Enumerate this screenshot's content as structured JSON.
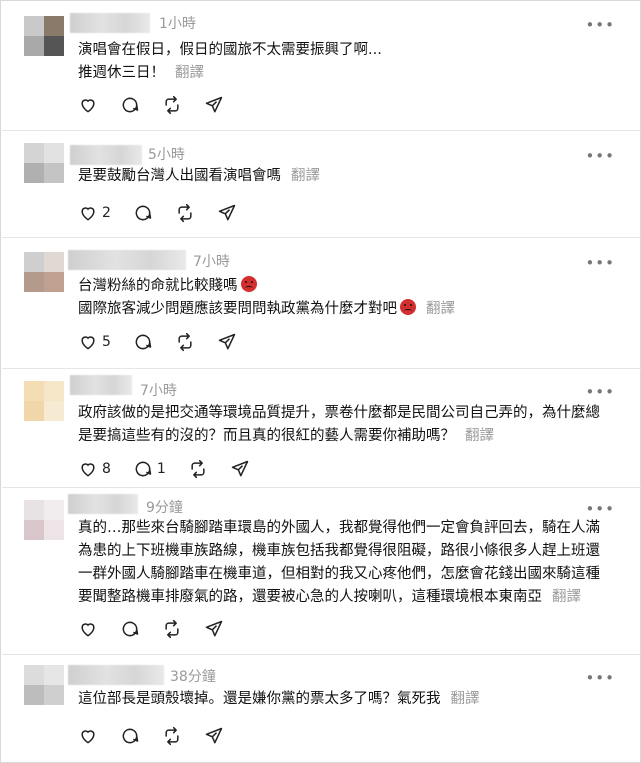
{
  "posts": [
    {
      "time": "1小時",
      "lines": [
        "演唱會在假日，假日的國旅不太需要振興了啊...",
        "推週休三日！"
      ],
      "translate": "翻譯",
      "likes": "",
      "replies": ""
    },
    {
      "time": "5小時",
      "lines": [
        "是要鼓勵台灣人出國看演唱會嗎"
      ],
      "translate": "翻譯",
      "likes": "2",
      "replies": ""
    },
    {
      "time": "7小時",
      "lines": [
        "台灣粉絲的命就比較賤嗎",
        "國際旅客減少問題應該要問問執政黨為什麼才對吧"
      ],
      "translate": "翻譯",
      "likes": "5",
      "replies": ""
    },
    {
      "time": "7小時",
      "lines": [
        "政府該做的是把交通等環境品質提升，票卷什麼都是民間公司自己弄的，為什麼總",
        "是要搞這些有的沒的？而且真的很紅的藝人需要你補助嗎？"
      ],
      "translate": "翻譯",
      "likes": "8",
      "replies": "1"
    },
    {
      "time": "9分鐘",
      "lines": [
        "真的…那些來台騎腳踏車環島的外國人，我都覺得他們一定會負評回去，騎在人滿",
        "為患的上下班機車族路線，機車族包括我都覺得很阻礙，路很小條很多人趕上班還",
        "一群外國人騎腳踏車在機車道，但相對的我又心疼他們，怎麼會花錢出國來騎這種",
        "要聞整路機車排廢氣的路，還要被心急的人按喇叭，這種環境根本東南亞"
      ],
      "translate": "翻譯",
      "likes": "",
      "replies": ""
    },
    {
      "time": "38分鐘",
      "lines": [
        "這位部長是頭殼壞掉。還是嫌你黨的票太多了嗎？氣死我"
      ],
      "translate": "翻譯",
      "likes": "",
      "replies": ""
    }
  ],
  "icons": {
    "like": "heart-icon",
    "reply": "comment-icon",
    "repost": "repost-icon",
    "share": "send-icon",
    "more": "more-dots-icon",
    "emoji": "angry-face-emoji-icon"
  },
  "colors": {
    "muted": "#9a9a9a",
    "emoji": "#d32f2f"
  }
}
